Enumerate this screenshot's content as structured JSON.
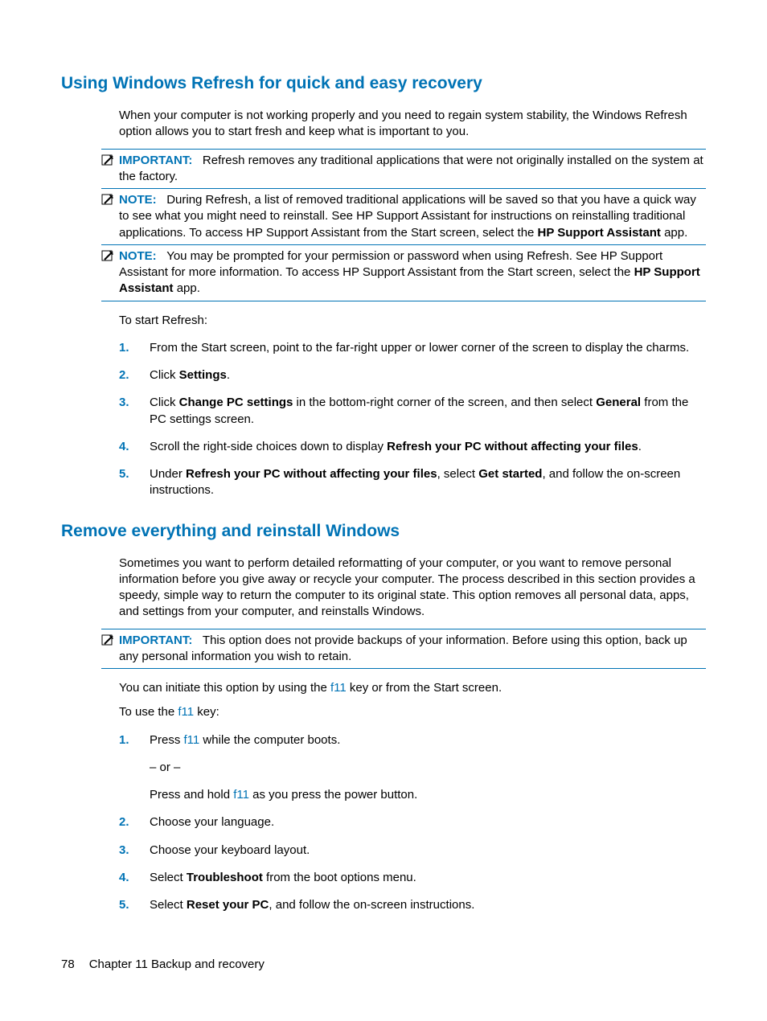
{
  "section1": {
    "heading": "Using Windows Refresh for quick and easy recovery",
    "intro": "When your computer is not working properly and you need to regain system stability, the Windows Refresh option allows you to start fresh and keep what is important to you.",
    "important": {
      "label": "IMPORTANT:",
      "text": "Refresh removes any traditional applications that were not originally installed on the system at the factory."
    },
    "note1": {
      "label": "NOTE:",
      "part1": "During Refresh, a list of removed traditional applications will be saved so that you have a quick way to see what you might need to reinstall. See HP Support Assistant for instructions on reinstalling traditional applications. To access HP Support Assistant from the Start screen, select the ",
      "bold": "HP Support Assistant",
      "part2": " app."
    },
    "note2": {
      "label": "NOTE:",
      "part1": "You may be prompted for your permission or password when using Refresh. See HP Support Assistant for more information. To access HP Support Assistant from the Start screen, select the ",
      "bold": "HP Support Assistant",
      "part2": " app."
    },
    "start_text": "To start Refresh:",
    "steps": {
      "s1": "From the Start screen, point to the far-right upper or lower corner of the screen to display the charms.",
      "s2_a": "Click ",
      "s2_b": "Settings",
      "s2_c": ".",
      "s3_a": "Click ",
      "s3_b": "Change PC settings",
      "s3_c": " in the bottom-right corner of the screen, and then select ",
      "s3_d": "General",
      "s3_e": " from the PC settings screen.",
      "s4_a": "Scroll the right-side choices down to display ",
      "s4_b": "Refresh your PC without affecting your files",
      "s4_c": ".",
      "s5_a": "Under ",
      "s5_b": "Refresh your PC without affecting your files",
      "s5_c": ", select ",
      "s5_d": "Get started",
      "s5_e": ", and follow the on-screen instructions."
    }
  },
  "section2": {
    "heading": "Remove everything and reinstall Windows",
    "intro": "Sometimes you want to perform detailed reformatting of your computer, or you want to remove personal information before you give away or recycle your computer. The process described in this section provides a speedy, simple way to return the computer to its original state. This option removes all personal data, apps, and settings from your computer, and reinstalls Windows.",
    "important": {
      "label": "IMPORTANT:",
      "text": "This option does not provide backups of your information. Before using this option, back up any personal information you wish to retain."
    },
    "para1_a": "You can initiate this option by using the ",
    "para1_f11": "f11",
    "para1_b": " key or from the Start screen.",
    "para2_a": "To use the ",
    "para2_f11": "f11",
    "para2_b": " key:",
    "steps": {
      "s1_a": "Press ",
      "s1_f11": "f11",
      "s1_b": " while the computer boots.",
      "s1_or": "– or –",
      "s1_c": "Press and hold ",
      "s1_f11b": "f11",
      "s1_d": " as you press the power button.",
      "s2": "Choose your language.",
      "s3": "Choose your keyboard layout.",
      "s4_a": "Select ",
      "s4_b": "Troubleshoot",
      "s4_c": " from the boot options menu.",
      "s5_a": "Select ",
      "s5_b": "Reset your PC",
      "s5_c": ", and follow the on-screen instructions."
    }
  },
  "footer": {
    "page": "78",
    "chapter": "Chapter 11   Backup and recovery"
  }
}
